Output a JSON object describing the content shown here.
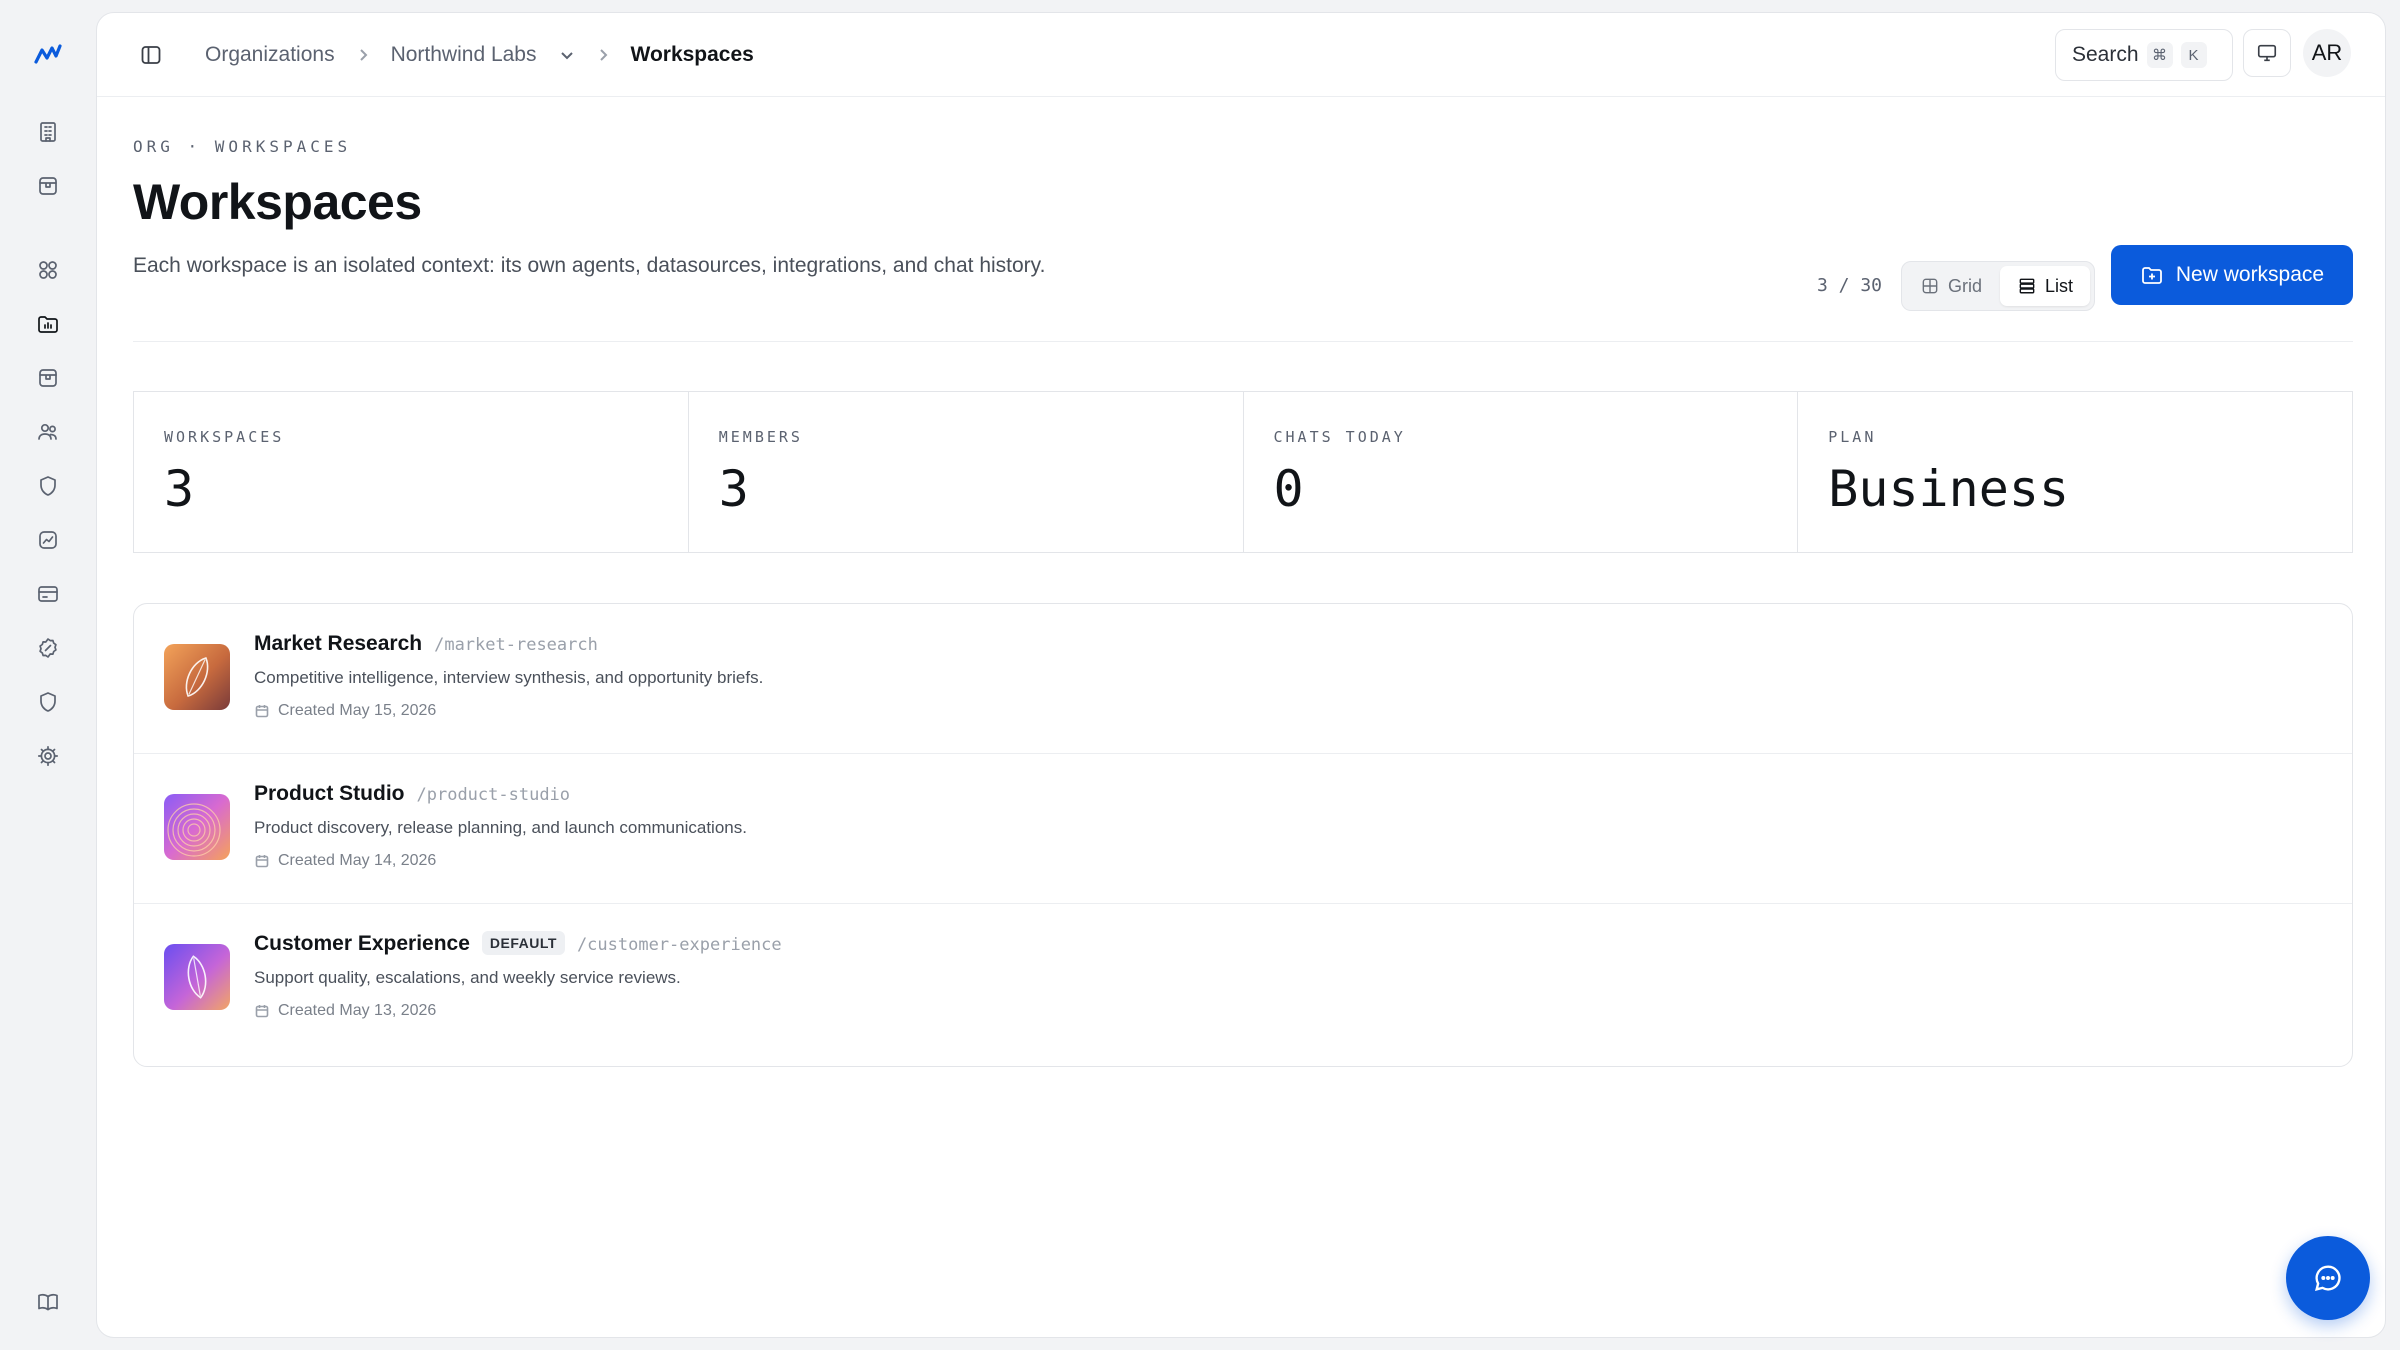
{
  "breadcrumb": {
    "root": "Organizations",
    "org": "Northwind Labs",
    "current": "Workspaces"
  },
  "topbar": {
    "search_label": "Search",
    "search_key_1": "⌘",
    "search_key_2": "K",
    "avatar_initials": "AR"
  },
  "header": {
    "eyebrow": "ORG · WORKSPACES",
    "title": "Workspaces",
    "description": "Each workspace is an isolated context: its own agents, datasources, integrations, and chat history.",
    "count": "3 / 30",
    "view_grid": "Grid",
    "view_list": "List",
    "active_view": "List",
    "new_button": "New workspace"
  },
  "stats": [
    {
      "label": "WORKSPACES",
      "value": "3"
    },
    {
      "label": "MEMBERS",
      "value": "3"
    },
    {
      "label": "CHATS TODAY",
      "value": "0"
    },
    {
      "label": "PLAN",
      "value": "Business"
    }
  ],
  "workspaces": [
    {
      "name": "Market Research",
      "badge": "",
      "slug": "/market-research",
      "description": "Competitive intelligence, interview synthesis, and opportunity briefs.",
      "created": "Created May 15, 2026",
      "icon": "leaf-icon"
    },
    {
      "name": "Product Studio",
      "badge": "",
      "slug": "/product-studio",
      "description": "Product discovery, release planning, and launch communications.",
      "created": "Created May 14, 2026",
      "icon": "ripple-icon"
    },
    {
      "name": "Customer Experience",
      "badge": "DEFAULT",
      "slug": "/customer-experience",
      "description": "Support quality, escalations, and weekly service reviews.",
      "created": "Created May 13, 2026",
      "icon": "leaf-icon"
    }
  ],
  "colors": {
    "accent": "#0b5bdc",
    "background": "#f2f3f5",
    "panel": "#ffffff"
  }
}
